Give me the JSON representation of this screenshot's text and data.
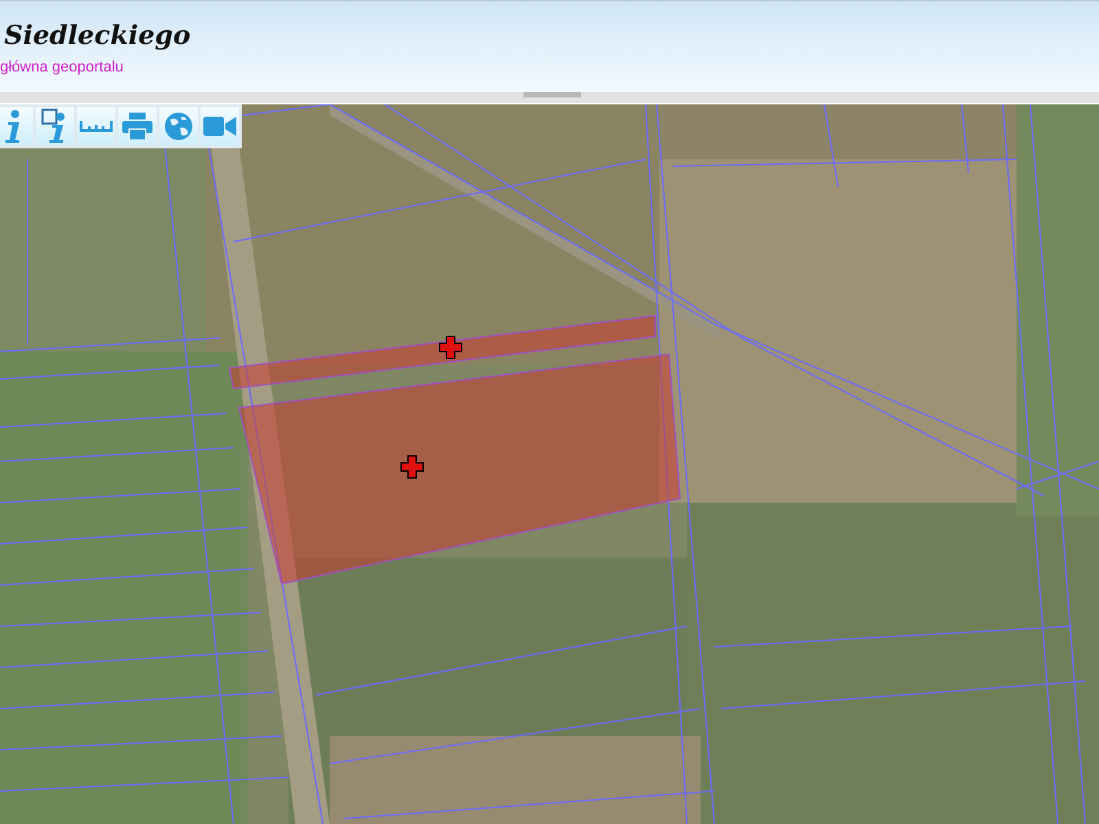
{
  "header": {
    "title": "Siedleckiego",
    "link": "główna geoportalu"
  },
  "toolbar": [
    {
      "kind": "info"
    },
    {
      "kind": "info-select"
    },
    {
      "kind": "measure"
    },
    {
      "kind": "print"
    },
    {
      "kind": "globe"
    },
    {
      "kind": "video"
    }
  ]
}
